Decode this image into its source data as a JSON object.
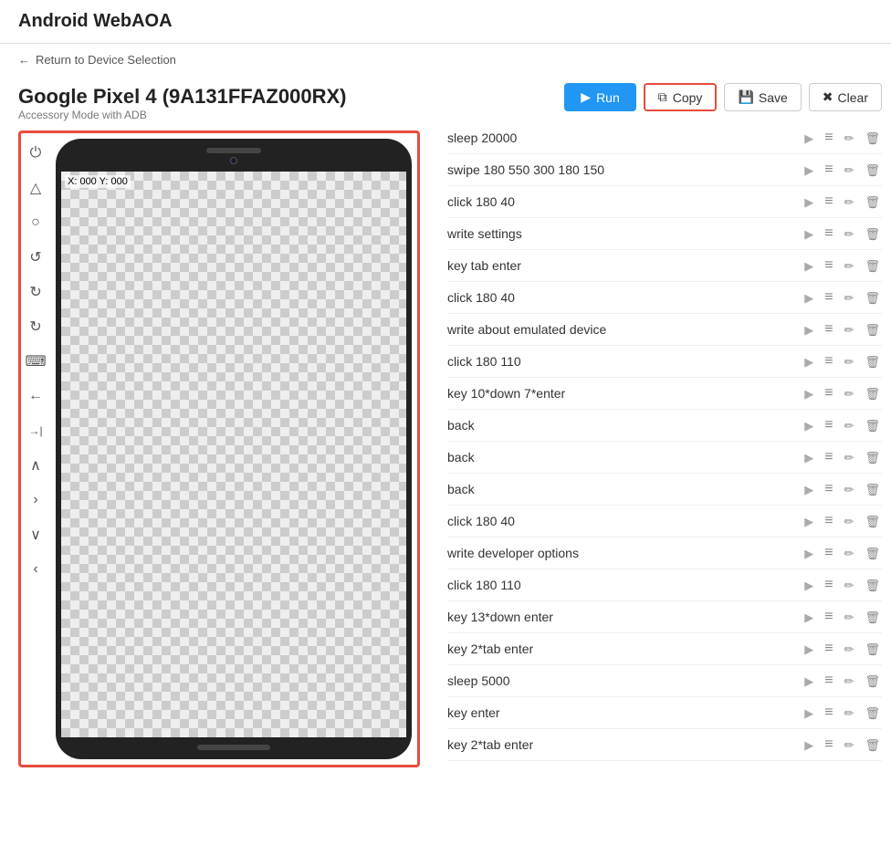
{
  "app": {
    "title": "Android WebAOA"
  },
  "nav": {
    "back_label": "Return to Device Selection"
  },
  "device": {
    "name": "Google Pixel 4 (9A131FFAZ000RX)",
    "mode": "Accessory Mode with ADB",
    "coords": "X: 000 Y: 000"
  },
  "toolbar": {
    "run_label": "Run",
    "copy_label": "Copy",
    "save_label": "Save",
    "clear_label": "Clear"
  },
  "commands": [
    {
      "id": 1,
      "text": "sleep 20000"
    },
    {
      "id": 2,
      "text": "swipe 180 550 300 180 150"
    },
    {
      "id": 3,
      "text": "click 180 40"
    },
    {
      "id": 4,
      "text": "write settings"
    },
    {
      "id": 5,
      "text": "key tab enter"
    },
    {
      "id": 6,
      "text": "click 180 40"
    },
    {
      "id": 7,
      "text": "write about emulated device"
    },
    {
      "id": 8,
      "text": "click 180 110"
    },
    {
      "id": 9,
      "text": "key 10*down 7*enter"
    },
    {
      "id": 10,
      "text": "back"
    },
    {
      "id": 11,
      "text": "back"
    },
    {
      "id": 12,
      "text": "back"
    },
    {
      "id": 13,
      "text": "click 180 40"
    },
    {
      "id": 14,
      "text": "write developer options"
    },
    {
      "id": 15,
      "text": "click 180 110"
    },
    {
      "id": 16,
      "text": "key 13*down enter"
    },
    {
      "id": 17,
      "text": "key 2*tab enter"
    },
    {
      "id": 18,
      "text": "sleep 5000"
    },
    {
      "id": 19,
      "text": "key enter"
    },
    {
      "id": 20,
      "text": "key 2*tab enter"
    }
  ],
  "side_controls": [
    {
      "id": "power",
      "icon": "⏻",
      "label": "power-icon"
    },
    {
      "id": "home",
      "icon": "△",
      "label": "home-icon"
    },
    {
      "id": "circle",
      "icon": "○",
      "label": "circle-icon"
    },
    {
      "id": "rotate-ccw",
      "icon": "↺",
      "label": "rotate-ccw-icon"
    },
    {
      "id": "rotate-cw",
      "icon": "↻",
      "label": "rotate-cw-icon"
    },
    {
      "id": "rotate-cw2",
      "icon": "↻",
      "label": "rotate-cw2-icon"
    },
    {
      "id": "keyboard",
      "icon": "⌨",
      "label": "keyboard-icon"
    },
    {
      "id": "arrow-left",
      "icon": "←",
      "label": "arrow-left-icon"
    },
    {
      "id": "arrow-right-in",
      "icon": "→|",
      "label": "arrow-right-in-icon"
    },
    {
      "id": "chevron-up",
      "icon": "∧",
      "label": "chevron-up-icon"
    },
    {
      "id": "chevron-right",
      "icon": "›",
      "label": "chevron-right-icon"
    },
    {
      "id": "chevron-down",
      "icon": "∨",
      "label": "chevron-down-icon"
    },
    {
      "id": "chevron-left",
      "icon": "‹",
      "label": "chevron-left-icon"
    }
  ]
}
